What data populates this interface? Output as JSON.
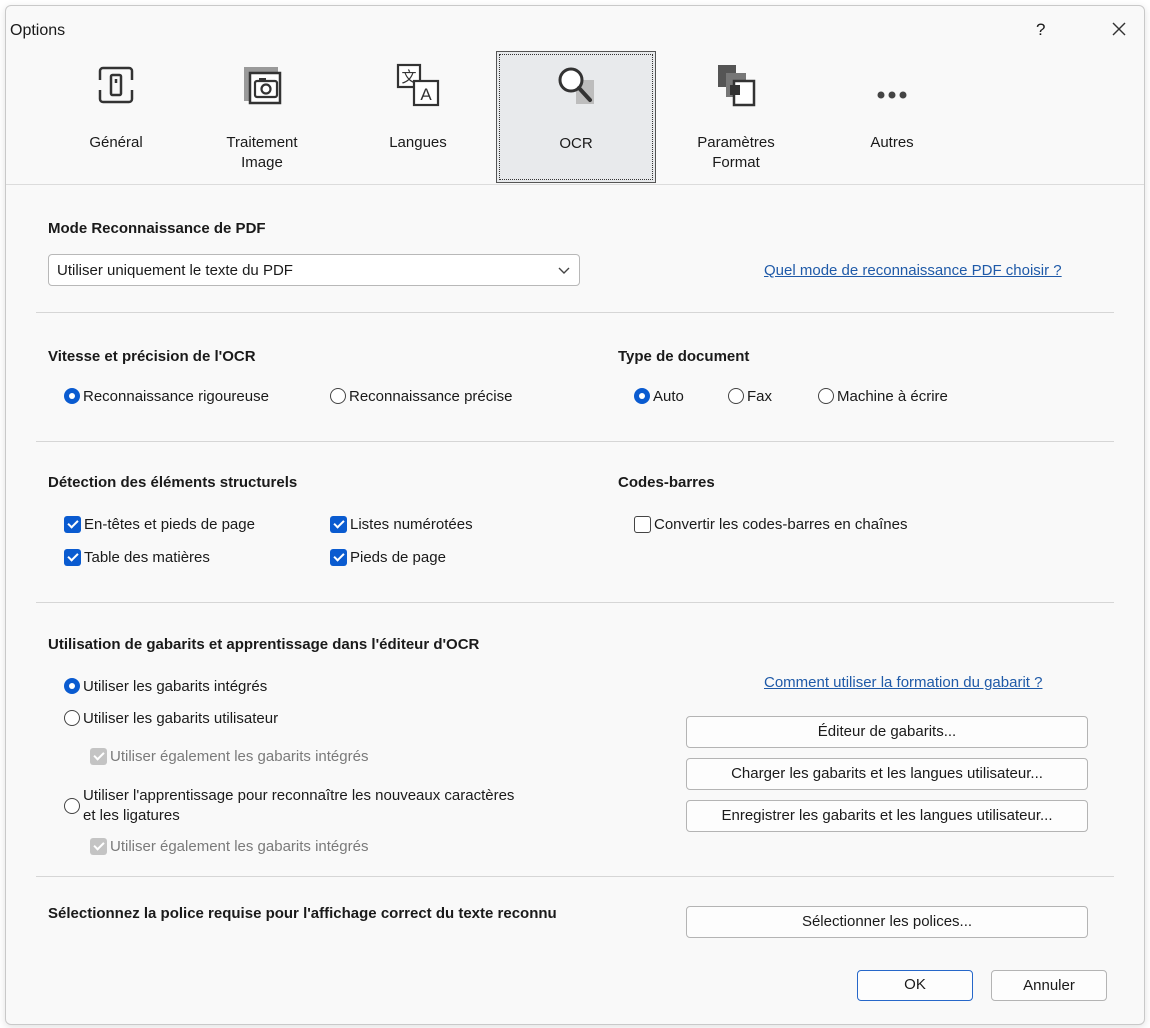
{
  "window": {
    "title": "Options",
    "help_label": "?"
  },
  "toolbar": [
    {
      "label": "Général"
    },
    {
      "label": "Traitement\nImage"
    },
    {
      "label": "Langues"
    },
    {
      "label": "OCR"
    },
    {
      "label": "Paramètres\nFormat"
    },
    {
      "label": "Autres"
    }
  ],
  "pdf_mode": {
    "heading": "Mode Reconnaissance de PDF",
    "selected": "Utiliser uniquement le texte du PDF",
    "help_link": "Quel mode de reconnaissance PDF choisir ?"
  },
  "speed": {
    "heading": "Vitesse et précision de l'OCR",
    "options": [
      "Reconnaissance rigoureuse",
      "Reconnaissance précise"
    ],
    "selected_index": 0
  },
  "doc_type": {
    "heading": "Type de document",
    "options": [
      "Auto",
      "Fax",
      "Machine à écrire"
    ],
    "selected_index": 0
  },
  "structure": {
    "heading": "Détection des éléments structurels",
    "items": [
      {
        "label": "En-têtes et pieds de page",
        "checked": true
      },
      {
        "label": "Listes numérotées",
        "checked": true
      },
      {
        "label": "Table des matières",
        "checked": true
      },
      {
        "label": "Pieds de page",
        "checked": true
      }
    ]
  },
  "barcodes": {
    "heading": "Codes-barres",
    "convert_label": "Convertir les codes-barres en chaînes",
    "checked": false
  },
  "templates": {
    "heading": "Utilisation de gabarits et apprentissage dans l'éditeur d'OCR",
    "help_link": "Comment utiliser la formation du gabarit ?",
    "opt_builtin": "Utiliser les gabarits intégrés",
    "opt_user": "Utiliser les gabarits utilisateur",
    "also_builtin_1": "Utiliser également les gabarits intégrés",
    "opt_learning": "Utiliser l'apprentissage pour reconnaître les nouveaux caractères et les ligatures",
    "also_builtin_2": "Utiliser également les gabarits intégrés",
    "selected": "builtin",
    "btn_editor": "Éditeur de gabarits...",
    "btn_load": "Charger les gabarits et les langues utilisateur...",
    "btn_save": "Enregistrer les gabarits et les langues utilisateur..."
  },
  "fonts": {
    "heading": "Sélectionnez la police requise pour l'affichage correct du texte reconnu",
    "btn_select": "Sélectionner les polices..."
  },
  "footer": {
    "ok": "OK",
    "cancel": "Annuler"
  },
  "colors": {
    "accent": "#0a5bd0",
    "link": "#1f5aa8"
  }
}
